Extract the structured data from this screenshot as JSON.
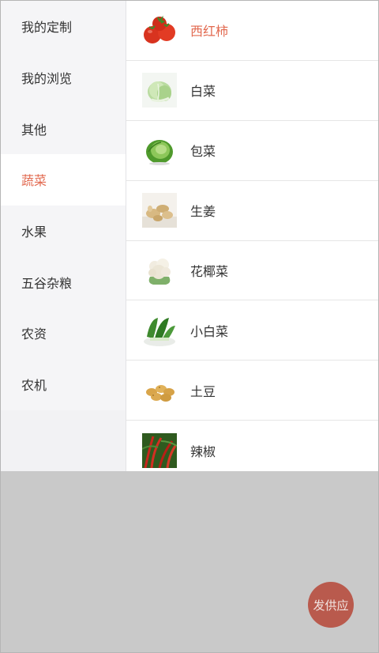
{
  "sidebar": {
    "items": [
      {
        "label": "我的定制"
      },
      {
        "label": "我的浏览"
      },
      {
        "label": "其他"
      },
      {
        "label": "蔬菜"
      },
      {
        "label": "水果"
      },
      {
        "label": "五谷杂粮"
      },
      {
        "label": "农资"
      },
      {
        "label": "农机"
      }
    ],
    "active_index": 3
  },
  "products": [
    {
      "label": "西红柿",
      "icon": "tomato-icon"
    },
    {
      "label": "白菜",
      "icon": "napa-cabbage-icon"
    },
    {
      "label": "包菜",
      "icon": "cabbage-icon"
    },
    {
      "label": "生姜",
      "icon": "ginger-icon"
    },
    {
      "label": "花椰菜",
      "icon": "cauliflower-icon"
    },
    {
      "label": "小白菜",
      "icon": "bok-choy-icon"
    },
    {
      "label": "土豆",
      "icon": "potato-icon"
    },
    {
      "label": "辣椒",
      "icon": "chili-pepper-icon"
    }
  ],
  "fab": {
    "label": "发供应"
  },
  "colors": {
    "accent": "#e2694f",
    "fab": "#b95a4d",
    "overlay": "#c9c9c9",
    "sidebar_bg": "#f5f5f7"
  }
}
